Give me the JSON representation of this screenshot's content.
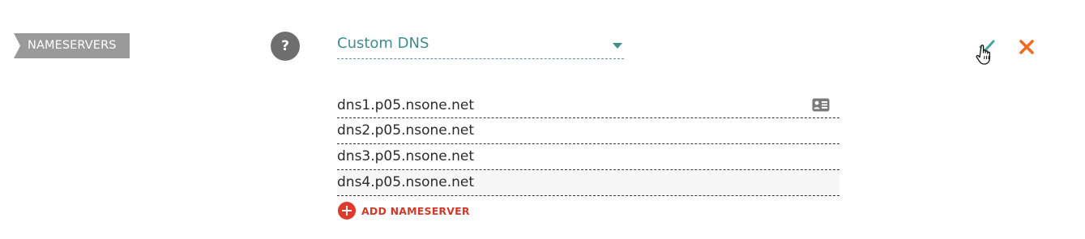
{
  "section": {
    "label": "NAMESERVERS",
    "help_symbol": "?"
  },
  "dns_select": {
    "value": "Custom DNS",
    "caret_icon": "caret-down-icon"
  },
  "actions": {
    "confirm_icon": "checkmark-icon",
    "cancel_icon": "close-x-icon",
    "cursor_icon": "hand-pointer-cursor-icon"
  },
  "nameservers": [
    {
      "value": "dns1.p05.nsone.net"
    },
    {
      "value": "dns2.p05.nsone.net"
    },
    {
      "value": "dns3.p05.nsone.net"
    },
    {
      "value": "dns4.p05.nsone.net"
    }
  ],
  "contact_card_icon": "contact-card-icon",
  "add_nameserver": {
    "label": "ADD NAMESERVER",
    "icon": "plus-circle-icon"
  },
  "colors": {
    "tag_bg": "#9a9a9a",
    "teal_accent": "#3e8e8a",
    "cancel_orange": "#f26a21",
    "add_red": "#d13a2a",
    "confirm_teal": "#4aa39e"
  }
}
